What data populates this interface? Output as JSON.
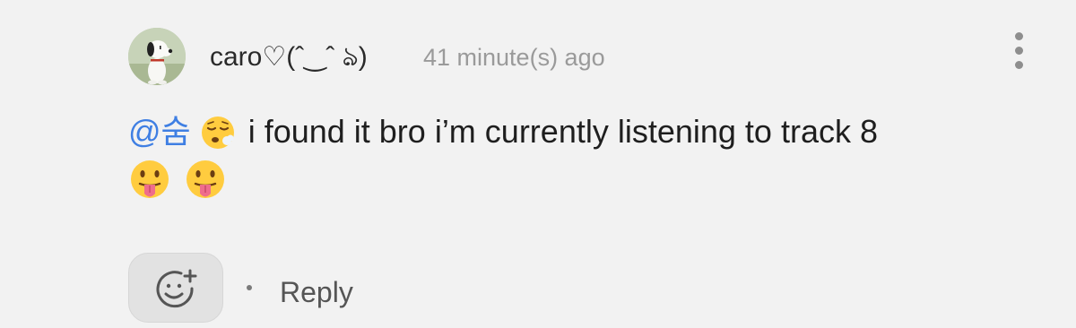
{
  "comment": {
    "username": "caro♡(ˆ‿ˆ ঌ)",
    "timestamp": "41 minute(s) ago",
    "mention": "@숨",
    "mention_emoji_icon": "sleepy-face-emoji",
    "text_line1": " i found it bro i’m currently listening to track 8",
    "trailing_emoji_icons": [
      "face-with-tongue-emoji",
      "face-with-tongue-emoji"
    ],
    "reply_label": "Reply"
  },
  "icons": {
    "more": "vertical-ellipsis-icon",
    "react": "add-reaction-icon"
  },
  "colors": {
    "background": "#f2f2f2",
    "mention": "#3f7fe3",
    "text": "#1e1e1e",
    "muted": "#9a9a9a"
  }
}
